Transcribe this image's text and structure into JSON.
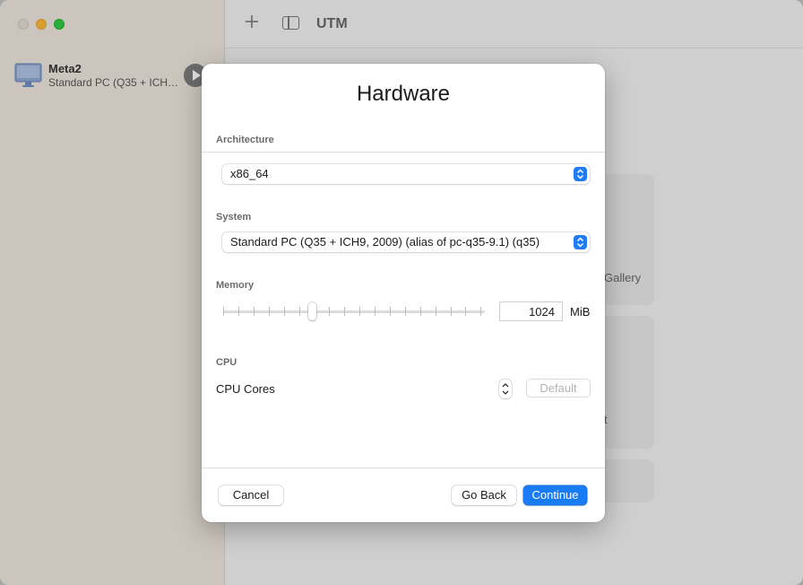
{
  "app": {
    "title": "UTM"
  },
  "sidebar": {
    "vm": {
      "name": "Meta2",
      "description": "Standard PC (Q35 + ICH…"
    }
  },
  "background": {
    "card_gallery": "Gallery",
    "card_partial": "t"
  },
  "dialog": {
    "title": "Hardware",
    "architecture": {
      "label": "Architecture",
      "value": "x86_64"
    },
    "system": {
      "label": "System",
      "value": "Standard PC (Q35 + ICH9, 2009) (alias of pc-q35-9.1) (q35)"
    },
    "memory": {
      "label": "Memory",
      "value": "1024",
      "unit": "MiB",
      "slider_fraction": 0.34
    },
    "cpu": {
      "label": "CPU",
      "cores_label": "CPU Cores",
      "default_label": "Default"
    },
    "buttons": {
      "cancel": "Cancel",
      "go_back": "Go Back",
      "continue": "Continue"
    }
  },
  "colors": {
    "accent": "#1a7cf5",
    "traffic_min": "#f6b43a",
    "traffic_max": "#2fc840"
  }
}
